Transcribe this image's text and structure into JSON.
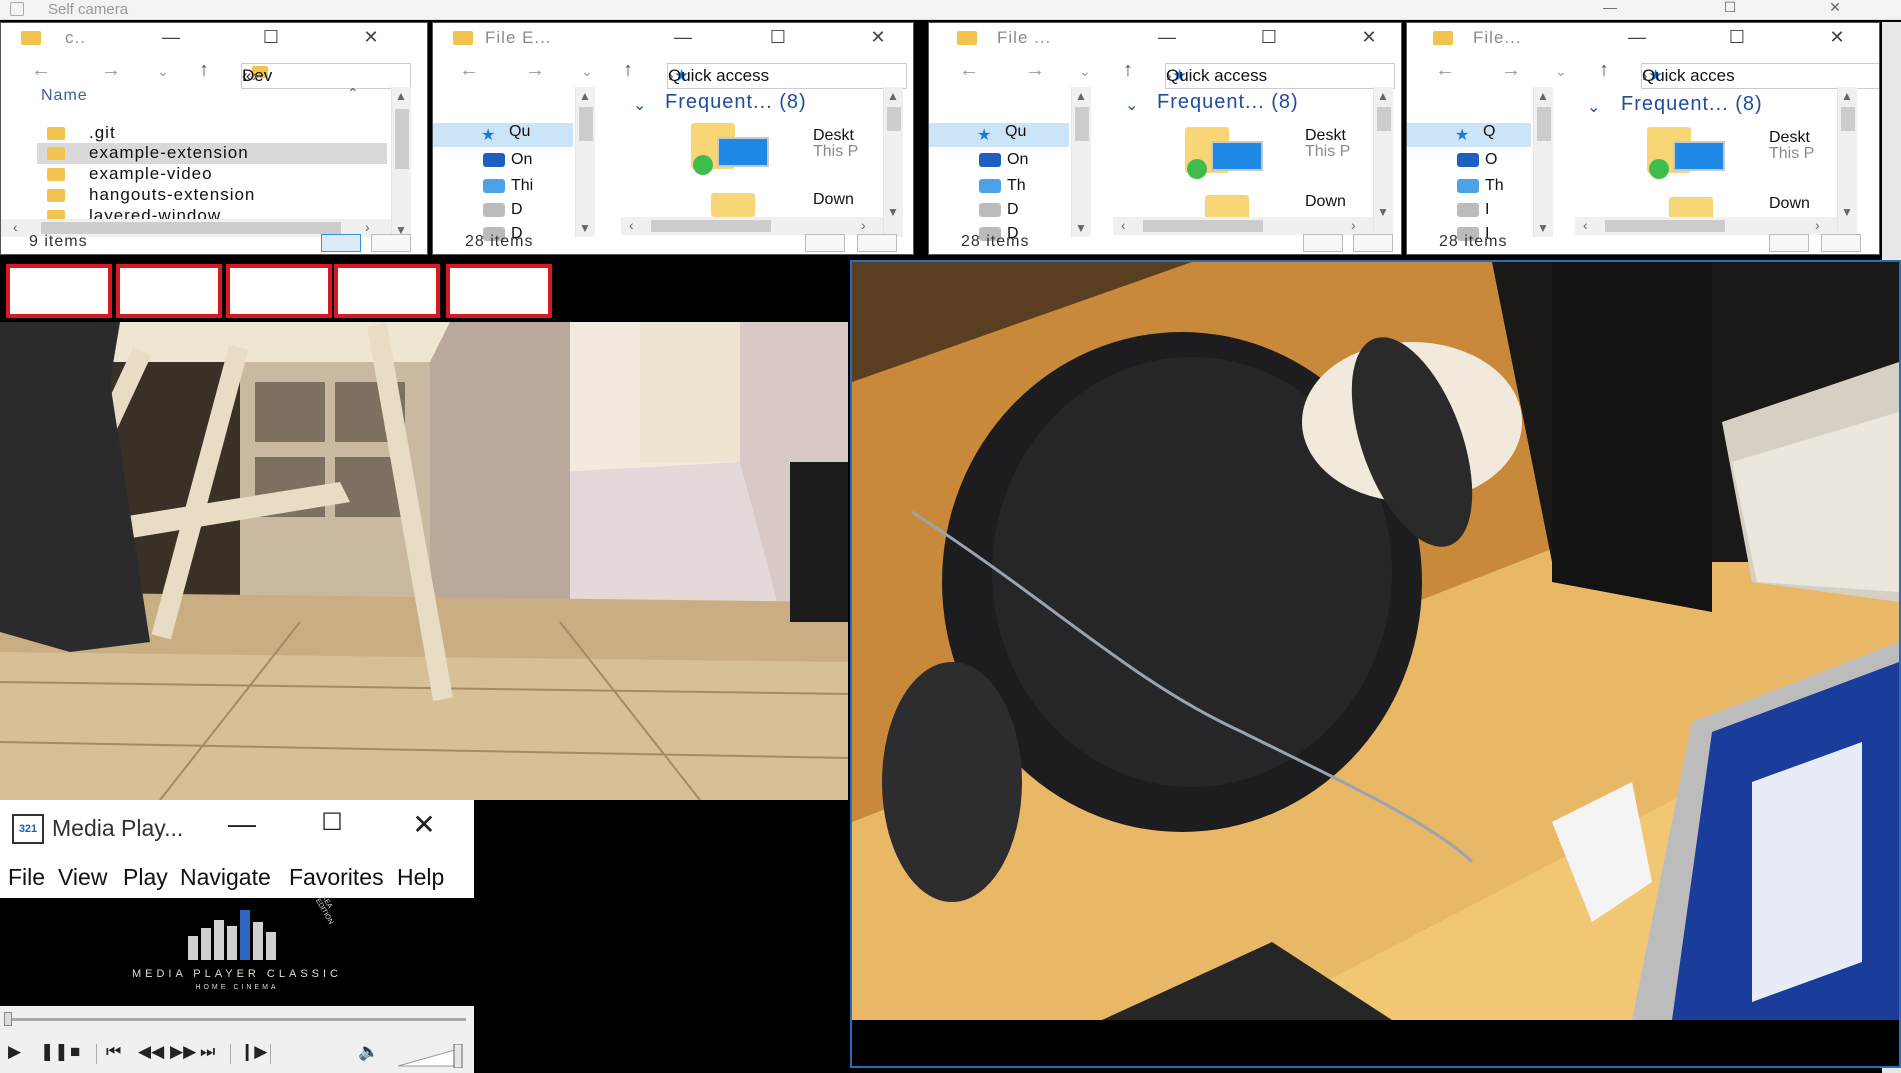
{
  "host": {
    "title": "Self camera"
  },
  "explorer1": {
    "title": "c..",
    "address": "Dev",
    "column": "Name",
    "files": [
      ".git",
      "example-extension",
      "example-video",
      "hangouts-extension",
      "layered-window"
    ],
    "status": "9 items"
  },
  "explorers": [
    {
      "title": "File E...",
      "address": "Quick access",
      "nav": [
        "Qu",
        "On",
        "Thi",
        "D",
        "D"
      ],
      "header": "Frequent... (8)",
      "tiles": [
        {
          "name": "Deskt",
          "sub": "This P"
        },
        {
          "name": "Down",
          "sub": ""
        }
      ],
      "status": "28 items"
    },
    {
      "title": "File ...",
      "address": "Quick access",
      "nav": [
        "Qu",
        "On",
        "Th",
        "D",
        "D"
      ],
      "header": "Frequent... (8)",
      "tiles": [
        {
          "name": "Deskt",
          "sub": "This P"
        },
        {
          "name": "Down",
          "sub": ""
        }
      ],
      "status": "28 items"
    },
    {
      "title": "File...",
      "address": "Quick acces",
      "nav": [
        "Q",
        "O",
        "Th",
        "I",
        "I"
      ],
      "header": "Frequent... (8)",
      "tiles": [
        {
          "name": "Deskt",
          "sub": "This P"
        },
        {
          "name": "Down",
          "sub": ""
        }
      ],
      "status": "28 items"
    }
  ],
  "mpc": {
    "title": "Media Play...",
    "menu": [
      "File",
      "View",
      "Play",
      "Navigate",
      "Favorites",
      "Help"
    ],
    "brand_main": "MEDIA PLAYER CLASSIC",
    "brand_sub": "HOME CINEMA",
    "brand_edition": "XEA EDITION"
  },
  "icons": {
    "close": "close-icon",
    "minimize": "minimize-icon",
    "maximize": "maximize-icon"
  },
  "colors": {
    "accent": "#1e7ad6",
    "red_button_border": "#d71a21",
    "camera_frame": "#2a6db5"
  }
}
